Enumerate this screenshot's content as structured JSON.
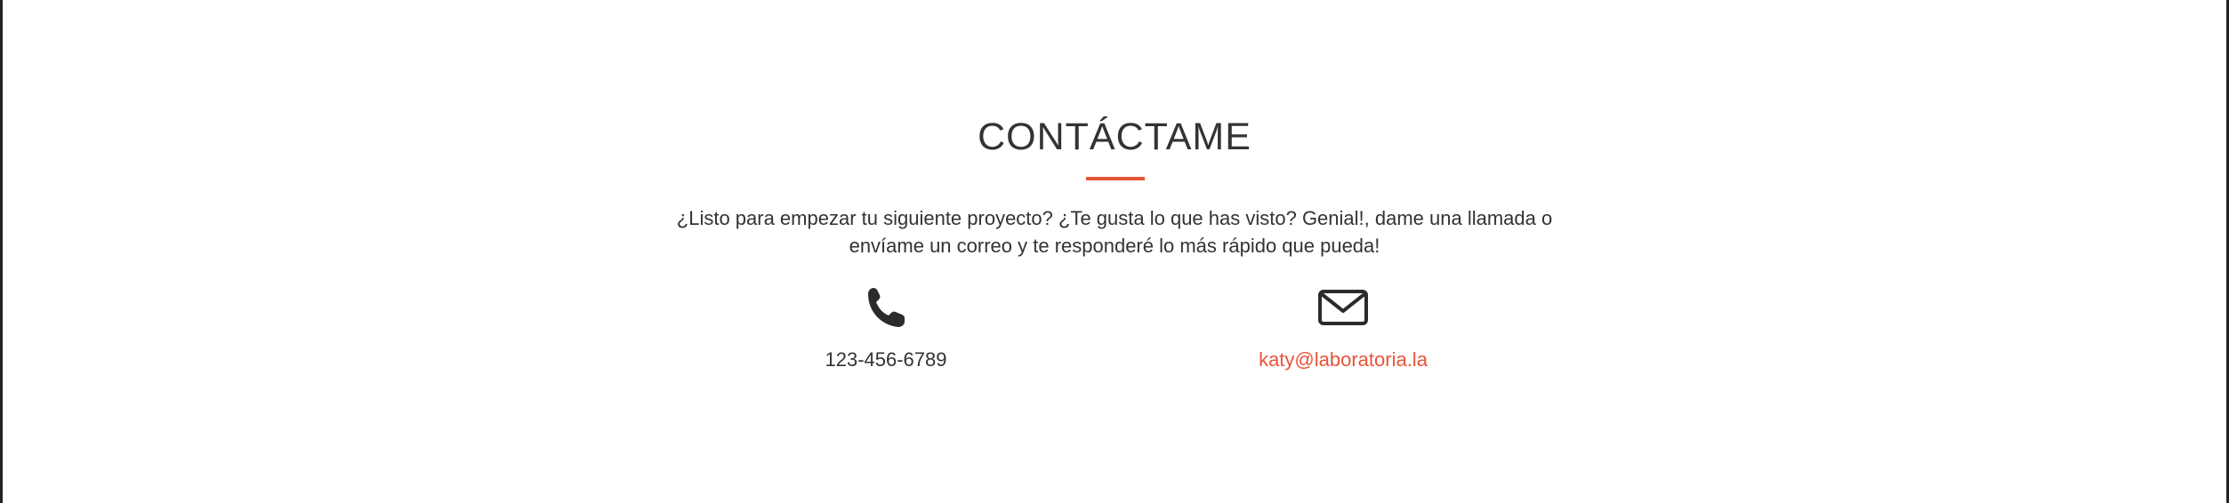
{
  "contact": {
    "title": "CONTÁCTAME",
    "description_line1": "¿Listo para empezar tu siguiente proyecto? ¿Te gusta lo que has visto? Genial!, dame una llamada o",
    "description_line2": "envíame un correo y te responderé lo más rápido que pueda!",
    "phone": {
      "icon": "phone-icon",
      "number": "123-456-6789"
    },
    "email": {
      "icon": "envelope-icon",
      "address": "katy@laboratoria.la"
    }
  },
  "colors": {
    "accent": "#e8543a",
    "text": "#333333",
    "background": "#ffffff"
  }
}
